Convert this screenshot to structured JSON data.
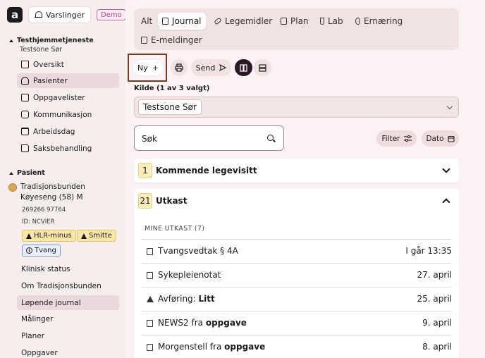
{
  "header": {
    "logo_letter": "a",
    "notifications_label": "Varslinger",
    "demo_badge": "Demo"
  },
  "org": {
    "title": "Testhjemmetjeneste",
    "subtitle": "Testsone Sør"
  },
  "nav": {
    "items": [
      {
        "label": "Oversikt",
        "icon": "home-icon",
        "active": false
      },
      {
        "label": "Pasienter",
        "icon": "people-icon",
        "active": true
      },
      {
        "label": "Oppgavelister",
        "icon": "checklist-icon",
        "active": false
      },
      {
        "label": "Kommunikasjon",
        "icon": "chat-icon",
        "active": false
      },
      {
        "label": "Arbeidsdag",
        "icon": "calendar-icon",
        "active": false
      },
      {
        "label": "Saksbehandling",
        "icon": "folder-icon",
        "active": false
      }
    ]
  },
  "patient": {
    "section_label": "Pasient",
    "name_line1": "Tradisjonsbunden",
    "name_line2": "Køyeseng (58) M",
    "ssn": "269266 97764",
    "id": "ID: NCVIER",
    "tags": [
      "HLR-minus",
      "Smitte",
      "Tvang"
    ],
    "links": [
      "Klinisk status",
      "Om Tradisjonsbunden",
      "Løpende journal",
      "Målinger",
      "Planer",
      "Oppgaver"
    ],
    "active_link": "Løpende journal"
  },
  "tabs": [
    {
      "label": "Alt",
      "icon": "",
      "active": false
    },
    {
      "label": "Journal",
      "icon": "journal-icon",
      "active": true
    },
    {
      "label": "Legemidler",
      "icon": "pill-icon",
      "active": false
    },
    {
      "label": "Plan",
      "icon": "plan-icon",
      "active": false
    },
    {
      "label": "Lab",
      "icon": "test-tube-icon",
      "active": false
    },
    {
      "label": "Ernæring",
      "icon": "nutrition-icon",
      "active": false
    },
    {
      "label": "E-meldinger",
      "icon": "message-icon",
      "active": false
    }
  ],
  "toolbar": {
    "new_label": "Ny",
    "new_symbol": "+",
    "send_label": "Send"
  },
  "source": {
    "label": "Kilde (1 av 3 valgt)",
    "selected": "Testsone Sør"
  },
  "search": {
    "placeholder": "Søk"
  },
  "filters": {
    "filter_label": "Filter",
    "date_label": "Dato"
  },
  "upcoming": {
    "count": "1",
    "title": "Kommende legevisitt"
  },
  "drafts": {
    "count": "21",
    "title": "Utkast",
    "subheading": "MINE UTKAST (7)",
    "rows": [
      {
        "text": "Tvangsvedtak § 4A",
        "bold": "",
        "date": "I går 13:35",
        "icon": "document-icon"
      },
      {
        "text": "Sykepleienotat",
        "bold": "",
        "date": "27. april",
        "icon": "document-icon"
      },
      {
        "text": "Avføring: ",
        "bold": "Litt",
        "date": "25. april",
        "icon": "warning-icon"
      },
      {
        "text": "NEWS2 fra ",
        "bold": "oppgave",
        "date": "9. april",
        "icon": "chart-icon"
      },
      {
        "text": "Morgenstell fra ",
        "bold": "oppgave",
        "date": "8. april",
        "icon": "document-icon"
      }
    ]
  }
}
